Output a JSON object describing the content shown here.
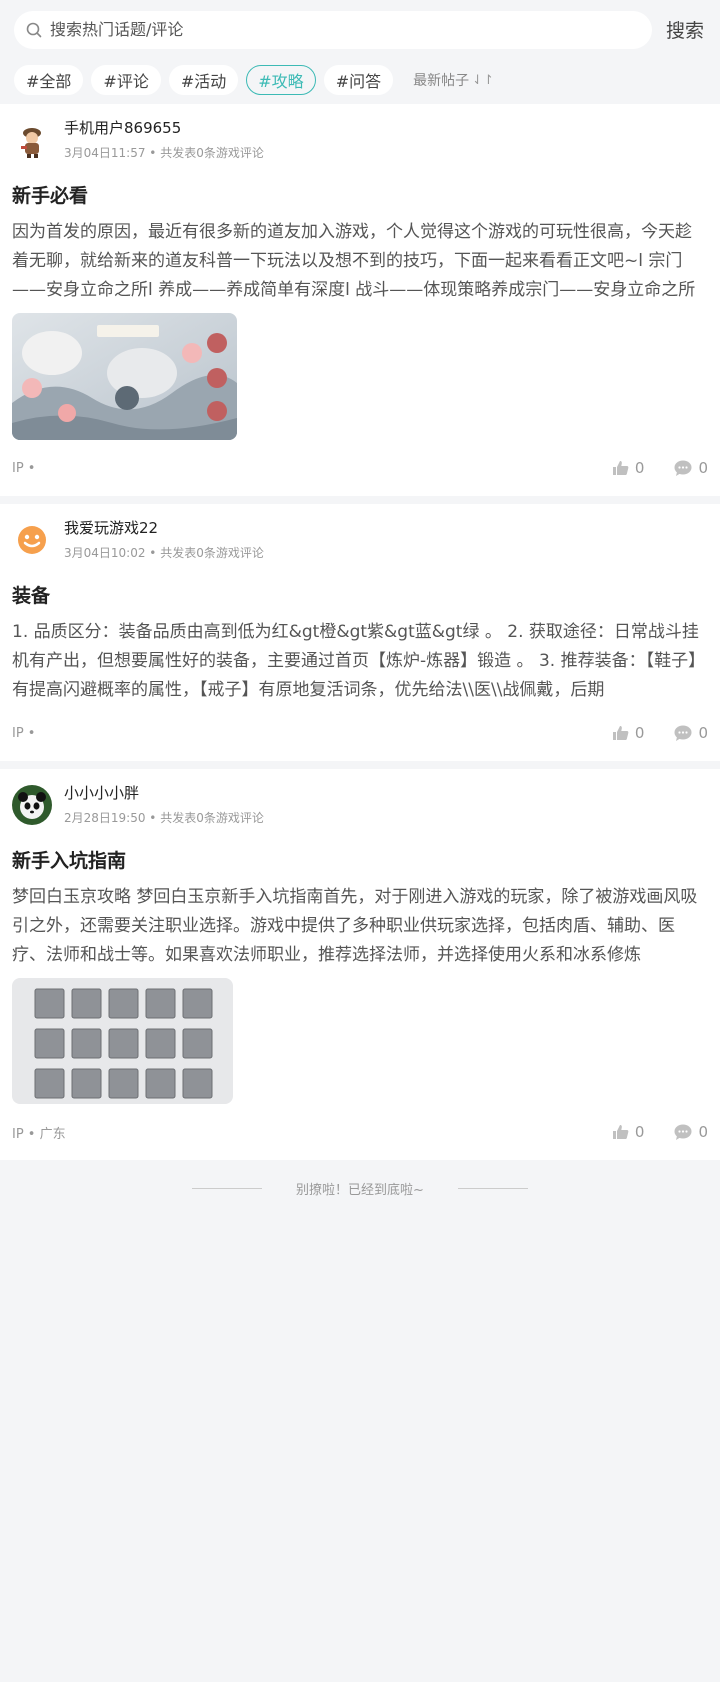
{
  "search": {
    "placeholder": "搜索热门话题/评论",
    "button_label": "搜索"
  },
  "tags": [
    {
      "label": "#全部",
      "active": false
    },
    {
      "label": "#评论",
      "active": false
    },
    {
      "label": "#活动",
      "active": false
    },
    {
      "label": "#攻略",
      "active": true
    },
    {
      "label": "#问答",
      "active": false
    }
  ],
  "sort": {
    "label": "最新帖子",
    "icon": "sort-arrows-icon"
  },
  "accent_color": "#3cbab5",
  "posts": [
    {
      "user": "手机用户869655",
      "meta": "3月04日11:57 • 共发表0条游戏评论",
      "title": "新手必看",
      "body": "因为首发的原因，最近有很多新的道友加入游戏，个人觉得这个游戏的可玩性很高，今天趁着无聊，就给新来的道友科普一下玩法以及想不到的技巧，下面一起来看看正文吧~l 宗门——安身立命之所l 养成——养成简单有深度l 战斗——体现策略养成宗门——安身立命之所",
      "ip": "IP •",
      "likes": "0",
      "comments": "0",
      "avatar_icon": "character-avatar-icon",
      "image": "game-map-image"
    },
    {
      "user": "我爱玩游戏22",
      "meta": "3月04日10:02 • 共发表0条游戏评论",
      "title": "装备",
      "body": "1. 品质区分：装备品质由高到低为红&gt橙&gt紫&gt蓝&gt绿 。 2. 获取途径：日常战斗挂机有产出，但想要属性好的装备，主要通过首页【炼炉-炼器】锻造 。 3. 推荐装备：【鞋子】有提高闪避概率的属性，【戒子】有原地复活词条，优先给法\\\\医\\\\战佩戴，后期",
      "ip": "IP •",
      "likes": "0",
      "comments": "0",
      "avatar_icon": "smiley-avatar-icon"
    },
    {
      "user": "小小小小胖",
      "meta": "2月28日19:50 • 共发表0条游戏评论",
      "title": "新手入坑指南",
      "body": "梦回白玉京攻略 梦回白玉京新手入坑指南首先，对于刚进入游戏的玩家，除了被游戏画风吸引之外，还需要关注职业选择。游戏中提供了多种职业供玩家选择，包括肉盾、辅助、医疗、法师和战士等。如果喜欢法师职业，推荐选择法师，并选择使用火系和冰系修炼",
      "ip": "IP • 广东",
      "likes": "0",
      "comments": "0",
      "avatar_icon": "panda-avatar-icon",
      "image": "inventory-grid-image"
    }
  ],
  "footer": "别撩啦！已经到底啦~"
}
